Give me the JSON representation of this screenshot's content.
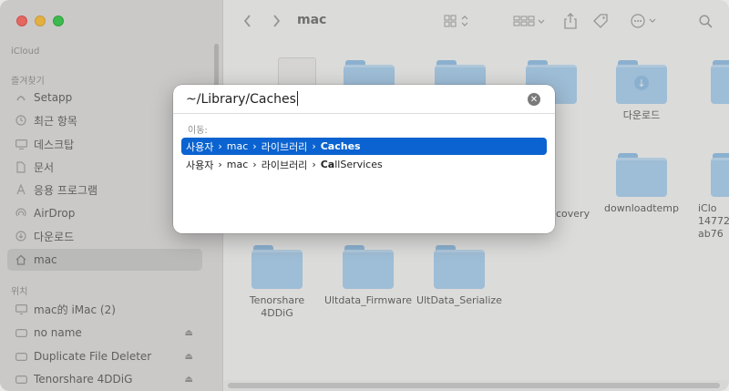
{
  "window": {
    "title": "mac"
  },
  "sidebar": {
    "sections": [
      {
        "label": "iCloud"
      },
      {
        "label": "즐겨찾기"
      },
      {
        "label": "위치"
      }
    ],
    "items": [
      {
        "label": "Setapp",
        "icon": "setapp-icon"
      },
      {
        "label": "최근 항목",
        "icon": "clock-icon"
      },
      {
        "label": "데스크탑",
        "icon": "desktop-icon"
      },
      {
        "label": "문서",
        "icon": "document-icon"
      },
      {
        "label": "응용 프로그램",
        "icon": "applications-icon"
      },
      {
        "label": "AirDrop",
        "icon": "airdrop-icon"
      },
      {
        "label": "다운로드",
        "icon": "download-icon"
      },
      {
        "label": "mac",
        "icon": "home-icon"
      },
      {
        "label": "mac的 iMac (2)",
        "icon": "imac-icon"
      },
      {
        "label": "no name",
        "icon": "drive-icon"
      },
      {
        "label": "Duplicate File Deleter",
        "icon": "drive-icon"
      },
      {
        "label": "Tenorshare 4DDiG",
        "icon": "drive-icon"
      }
    ],
    "selected": "mac"
  },
  "content": {
    "items": [
      {
        "label": "다운로드",
        "icon": "download-glyph"
      },
      {
        "label": "covery"
      },
      {
        "label": "downloadtemp"
      },
      {
        "label": "iClo\n14772\nab76"
      },
      {
        "label": "Tenorshare\n4DDiG"
      },
      {
        "label": "Ultdata_Firmware"
      },
      {
        "label": "UltData_Serialize"
      }
    ]
  },
  "goto": {
    "input_value": "~/Library/Caches",
    "section_label": "이동:",
    "suggestions": [
      {
        "parts": [
          "사용자",
          "mac",
          "라이브러리"
        ],
        "prefix": "",
        "match": "Caches",
        "rest": ""
      },
      {
        "parts": [
          "사용자",
          "mac",
          "라이브러리"
        ],
        "prefix": "",
        "match": "Ca",
        "rest": "llServices"
      }
    ],
    "separator": "›"
  },
  "colors": {
    "accent": "#0a63d0",
    "folder": "#a6cdee"
  }
}
